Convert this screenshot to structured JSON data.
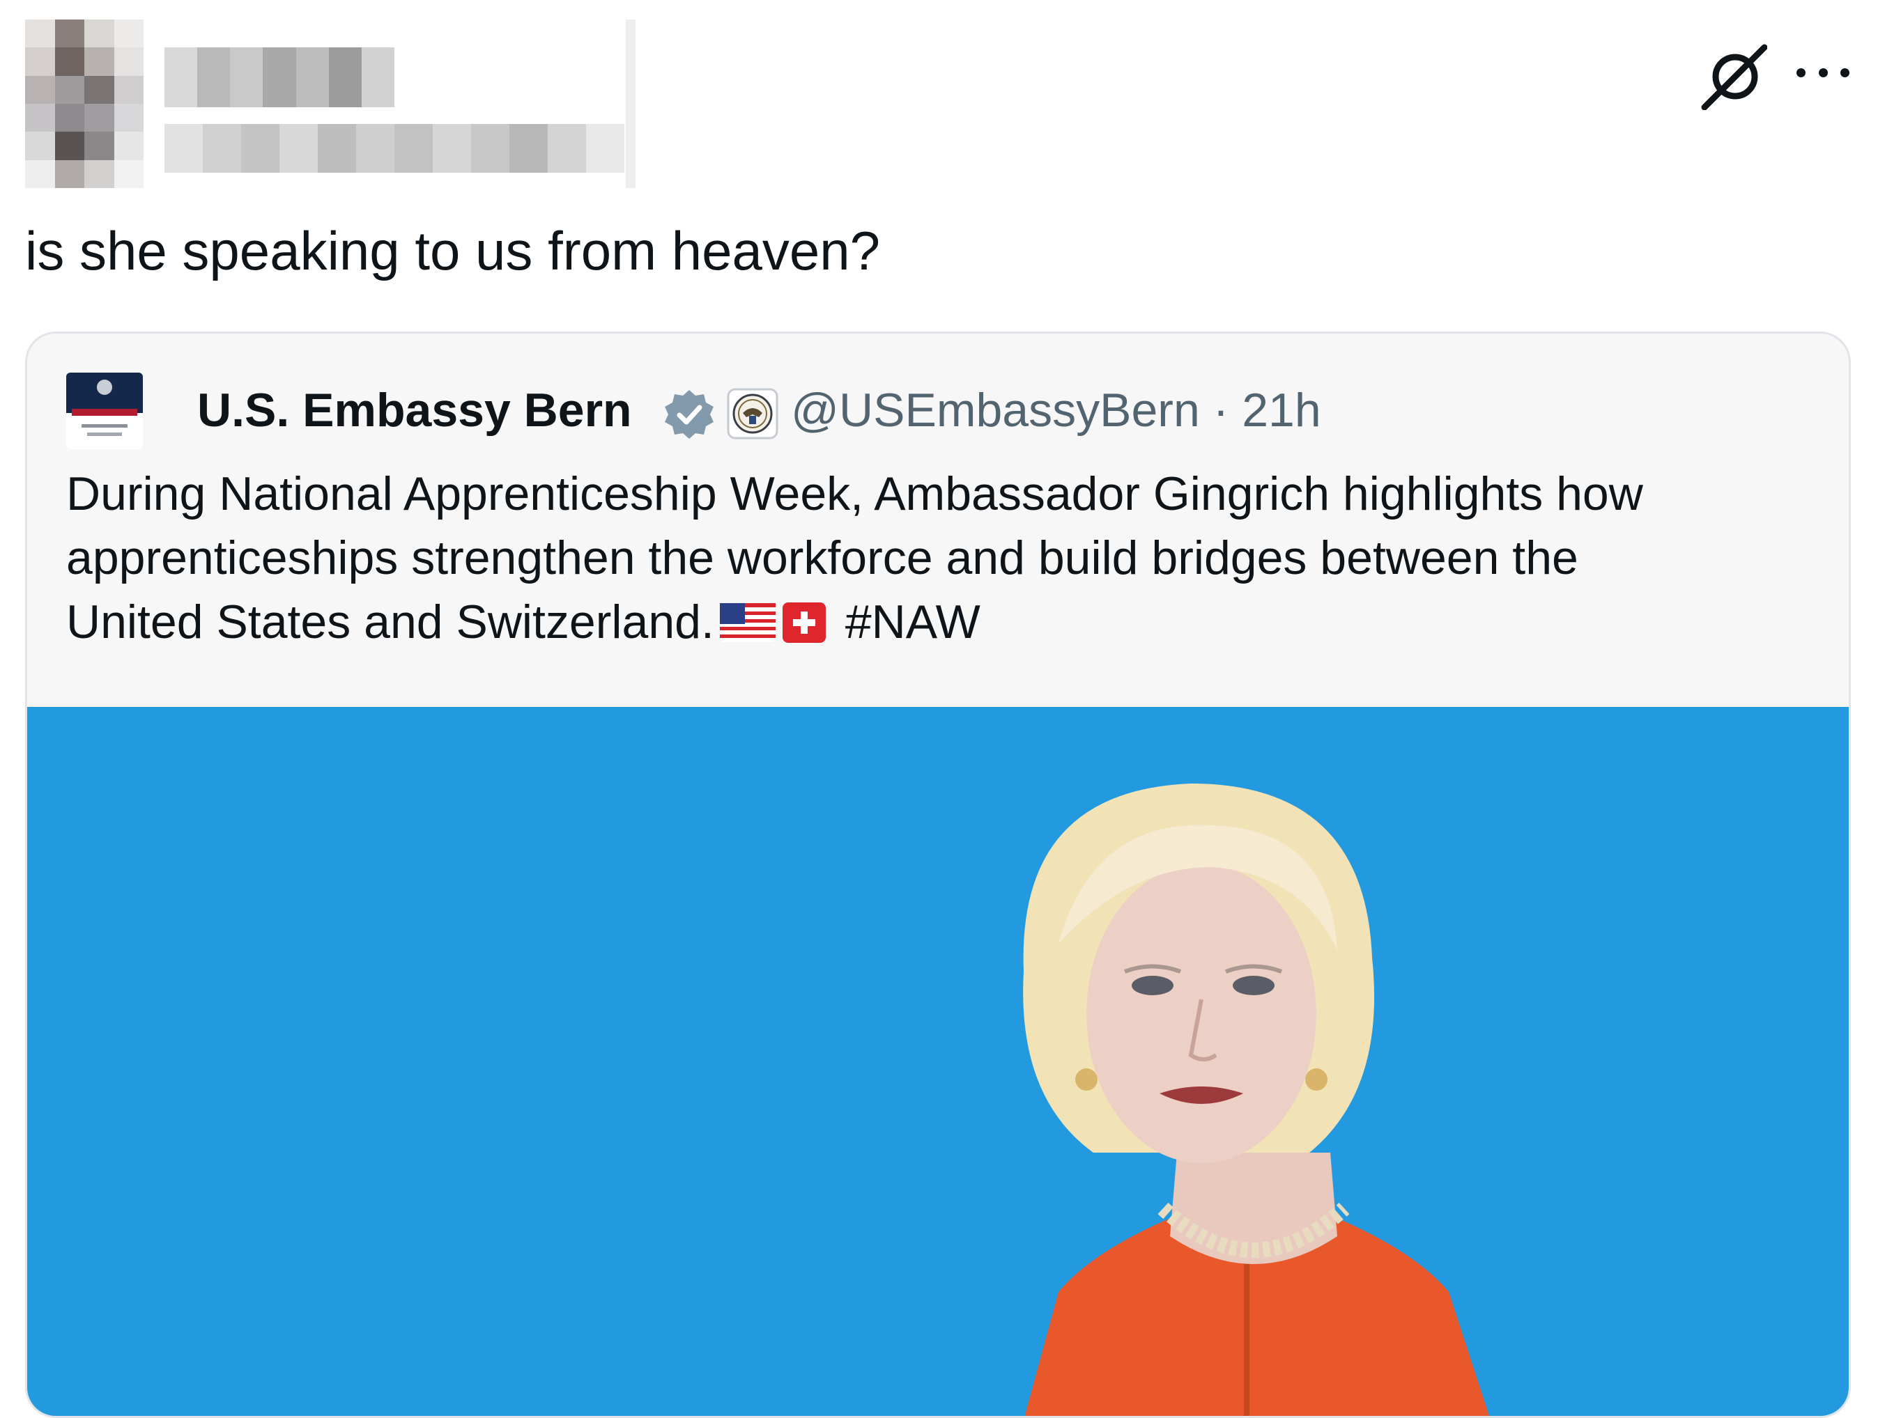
{
  "post": {
    "author_name": "",
    "author_handle": "",
    "text": "is she speaking to us from heaven?"
  },
  "actions": {
    "grok_icon": "grok-icon",
    "more_icon": "more-icon"
  },
  "quoted_post": {
    "author_name": "U.S. Embassy Bern",
    "handle_and_time": "@USEmbassyBern · 21h",
    "text_lines": [
      "During National Apprenticeship Week, Ambassador Gingrich highlights how",
      "apprenticeships strengthen the workforce and build bridges between the",
      "United States and Switzerland."
    ],
    "hashtag": "#NAW",
    "emoji": [
      "us-flag",
      "swiss-flag"
    ],
    "verified_badge": "verified-badge-icon",
    "affiliation_badge": "government-seal-icon",
    "media_background": "#2399df"
  },
  "colors": {
    "text_primary": "#0f1419",
    "text_secondary": "#536471",
    "border": "#e1e5e9"
  }
}
